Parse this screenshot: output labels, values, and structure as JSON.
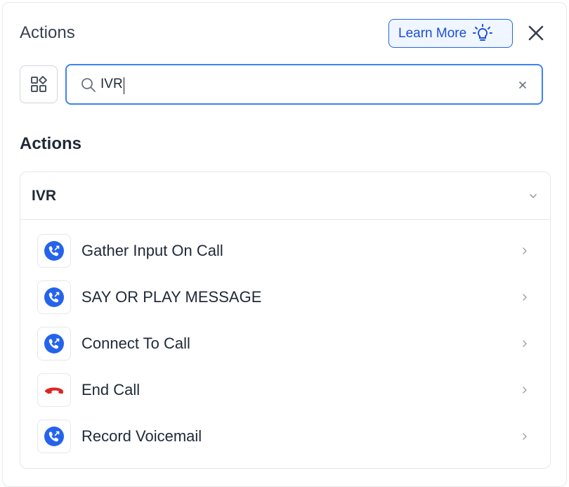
{
  "header": {
    "title": "Actions",
    "learn_more_label": "Learn More",
    "learn_more_icon": "lightbulb-icon",
    "close_icon": "close-icon"
  },
  "search": {
    "value": "IVR",
    "placeholder": "",
    "icon": "search-icon",
    "clear_icon": "clear-icon"
  },
  "toolbar": {
    "grid_icon": "grid-shapes-icon"
  },
  "section": {
    "title": "Actions"
  },
  "group": {
    "title": "IVR",
    "expanded": true,
    "items": [
      {
        "label": "Gather Input On Call",
        "icon": "phone-call-icon"
      },
      {
        "label": "SAY OR PLAY MESSAGE",
        "icon": "phone-call-icon"
      },
      {
        "label": "Connect To Call",
        "icon": "phone-call-icon"
      },
      {
        "label": "End Call",
        "icon": "hang-up-icon"
      },
      {
        "label": "Record Voicemail",
        "icon": "phone-call-icon"
      }
    ]
  },
  "colors": {
    "accent": "#2563eb",
    "phone_blue": "#2563eb",
    "hangup_red": "#dc2626",
    "border": "#e5e7eb"
  }
}
